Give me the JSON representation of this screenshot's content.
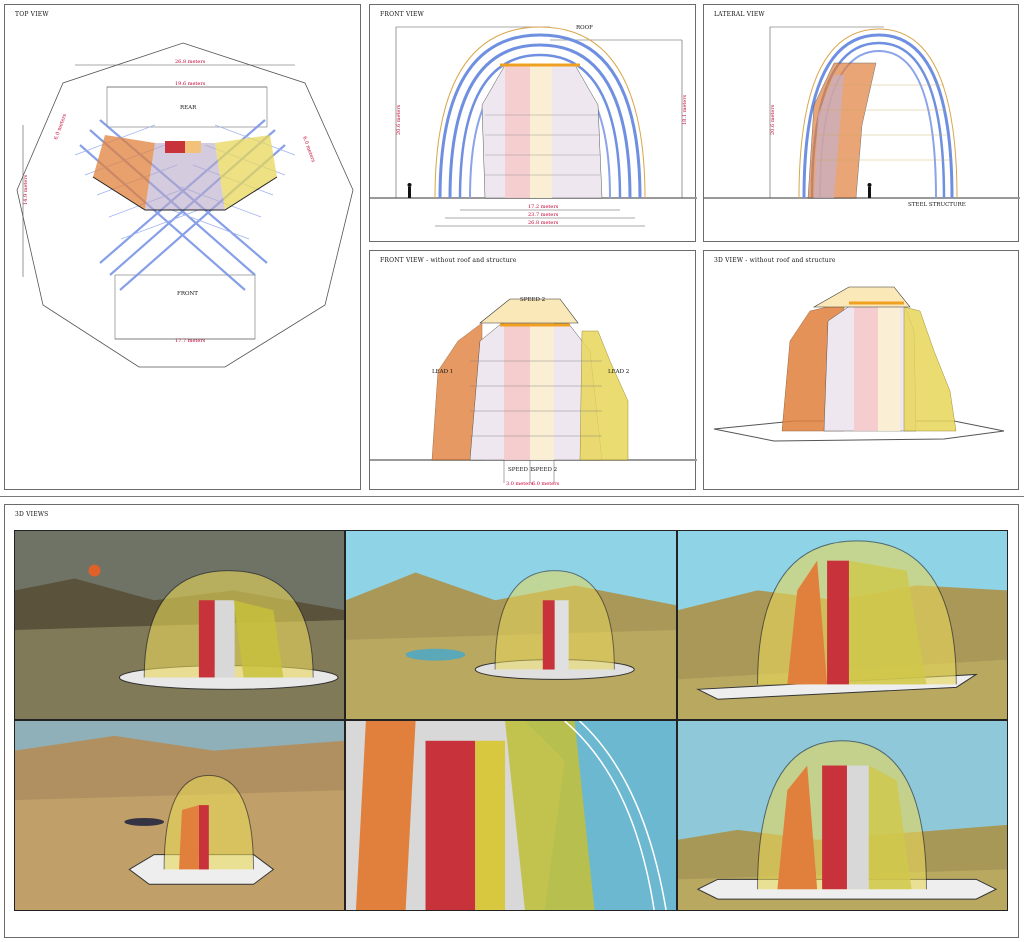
{
  "top_view": {
    "title": "TOP VIEW",
    "rear_label": "REAR",
    "front_label": "FRONT",
    "dim_width_outer": "26.8 meters",
    "dim_width_inner": "19.6 meters",
    "dim_depth": "14.9 meters",
    "dim_side_left": "6.0 meters",
    "dim_side_right": "6.0 meters",
    "dim_front": "17.7 meters"
  },
  "front_view": {
    "title": "FRONT VIEW",
    "roof_label": "ROOF",
    "dim_height_left": "20.6 meters",
    "dim_height_right": "18.1 meters",
    "dim_width_1": "17.2 meters",
    "dim_width_2": "23.7 meters",
    "dim_width_3": "26.8 meters"
  },
  "lateral_view": {
    "title": "LATERAL VIEW",
    "dim_height": "20.6 meters",
    "structure_label": "STEEL STRUCTURE"
  },
  "front_view_bare": {
    "title": "FRONT VIEW - without roof and structure",
    "speed2_top": "SPEED 2",
    "lead1": "LEAD 1",
    "lead2": "LEAD 2",
    "speed1": "SPEED 1",
    "speed2": "SPEED 2",
    "dim_left": "3.0 meters",
    "dim_right": "6.0 meters"
  },
  "view_3d_bare": {
    "title": "3D VIEW - without roof and structure"
  },
  "views_3d": {
    "title": "3D VIEWS"
  },
  "colors": {
    "frame_blue": "#6f8fe0",
    "roof_gold": "#d9a64a",
    "lead_orange": "#e0803c",
    "speed_red": "#c8323a",
    "speed_yellow": "#e8d75a",
    "dim_red": "#c3002f",
    "sand": "#a89858",
    "sky": "#8fd3e6"
  }
}
